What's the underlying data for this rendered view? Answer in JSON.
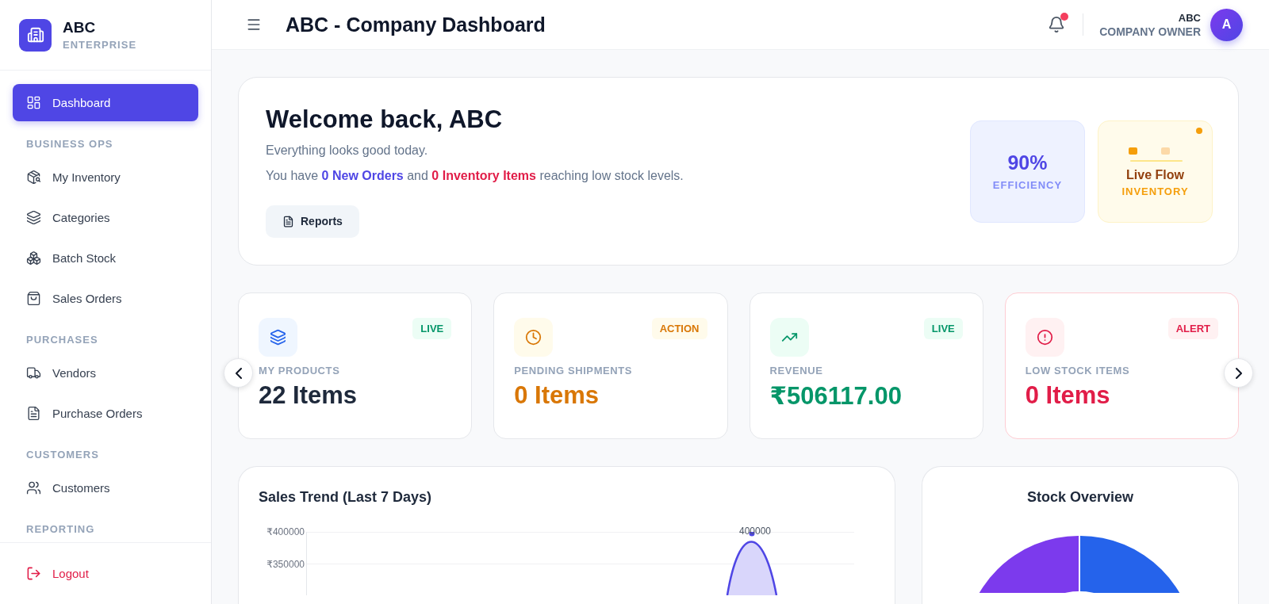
{
  "sidebar": {
    "brand": {
      "name": "ABC",
      "subtitle": "ENTERPRISE"
    },
    "nav": [
      {
        "kind": "item",
        "label": "Dashboard",
        "selected": true
      },
      {
        "kind": "section",
        "label": "BUSINESS OPS"
      },
      {
        "kind": "item",
        "label": "My Inventory",
        "selected": false
      },
      {
        "kind": "item",
        "label": "Categories",
        "selected": false
      },
      {
        "kind": "item",
        "label": "Batch Stock",
        "selected": false
      },
      {
        "kind": "item",
        "label": "Sales Orders",
        "selected": false
      },
      {
        "kind": "section",
        "label": "PURCHASES"
      },
      {
        "kind": "item",
        "label": "Vendors",
        "selected": false
      },
      {
        "kind": "item",
        "label": "Purchase Orders",
        "selected": false
      },
      {
        "kind": "section",
        "label": "CUSTOMERS"
      },
      {
        "kind": "item",
        "label": "Customers",
        "selected": false
      },
      {
        "kind": "section",
        "label": "REPORTING"
      }
    ],
    "logout": {
      "label": "Logout"
    }
  },
  "header": {
    "title": "ABC - Company Dashboard",
    "notification": true,
    "user": {
      "name": "ABC",
      "role": "COMPANY OWNER",
      "initial": "A"
    }
  },
  "welcome": {
    "title": "Welcome back, ABC",
    "subtitle": "Everything looks good today.",
    "message": "You have **0 New Orders** and **0 Inventory Items** reaching low stock levels.",
    "button": "Reports",
    "efficiency": {
      "value": "90%",
      "label": "EFFICIENCY"
    },
    "live_flow": {
      "title": "Live Flow",
      "label": "INVENTORY",
      "live": true
    }
  },
  "stats": [
    {
      "kind": "products",
      "badge": "LIVE",
      "label": "MY PRODUCTS",
      "value": "22 Items"
    },
    {
      "kind": "pending",
      "badge": "ACTION",
      "label": "PENDING SHIPMENTS",
      "value": "0 Items"
    },
    {
      "kind": "revenue",
      "badge": "LIVE",
      "label": "REVENUE",
      "value": "₹506117.00"
    },
    {
      "kind": "alert",
      "badge": "ALERT",
      "label": "LOW STOCK ITEMS",
      "value": "0 Items"
    }
  ],
  "sales_trend": {
    "title": "Sales Trend (Last 7 Days)",
    "y_labels": [
      "₹400000",
      "₹350000"
    ],
    "point_label": "400000"
  },
  "stock_overview": {
    "title": "Stock Overview"
  }
}
